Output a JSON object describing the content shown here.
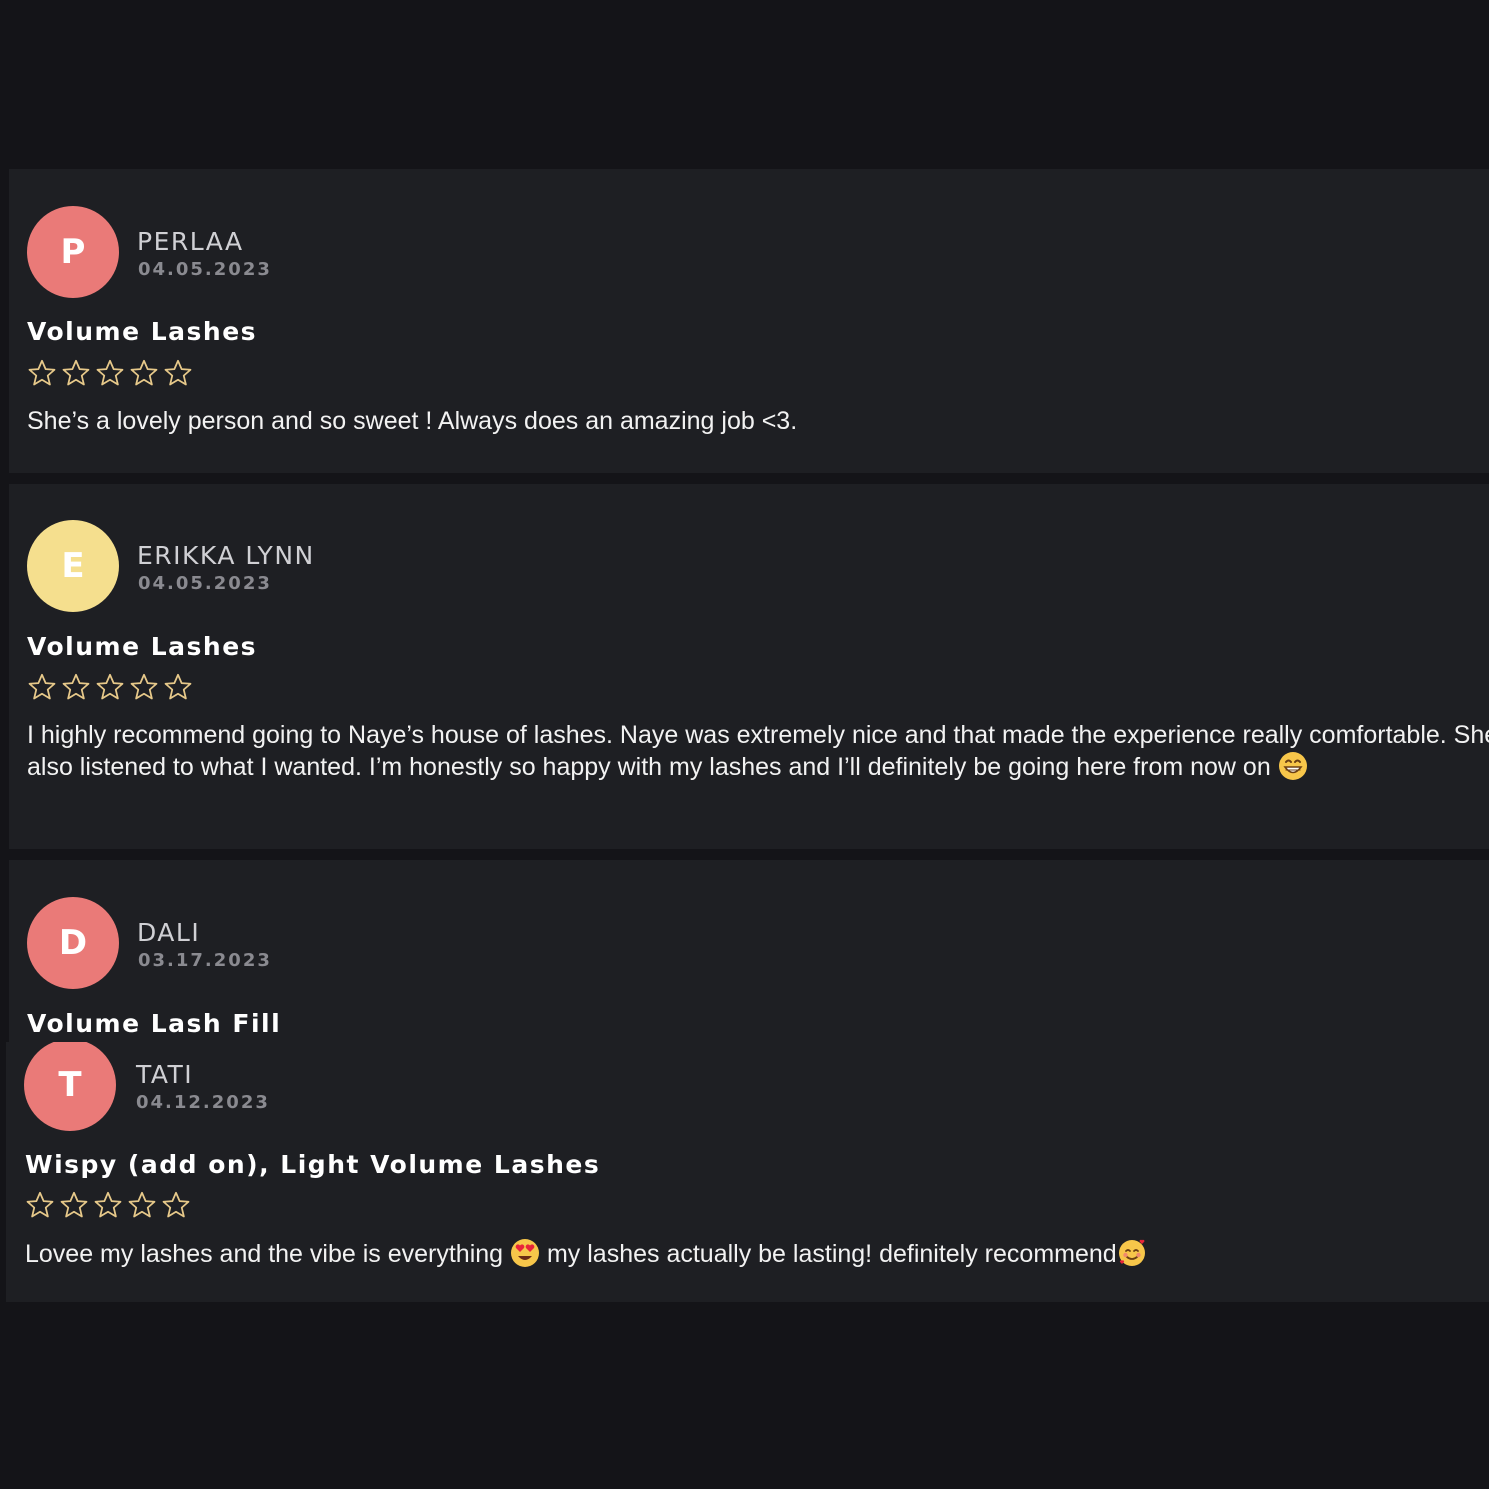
{
  "colors": {
    "background": "#141418",
    "card": "#1e1f23",
    "avatar_pink": "#ea7a78",
    "avatar_yellow": "#f5df8e",
    "star_outline": "#e7c98a"
  },
  "reviews": [
    {
      "initial": "P",
      "name": "PERLAA",
      "date": "04.05.2023",
      "service": "Volume Lashes",
      "rating": 5,
      "text": "She’s a lovely person and so sweet ! Always does an amazing job <3."
    },
    {
      "initial": "E",
      "name": "ERIKKA LYNN",
      "date": "04.05.2023",
      "service": "Volume Lashes",
      "rating": 5,
      "text": "I highly recommend going to Naye’s house of lashes. Naye was extremely nice and that made the experience really comfortable. She also listened to  what I wanted. I’m honestly so happy with my lashes and I’ll definitely be going here from now on",
      "emoji": "grinning-face-emoji"
    },
    {
      "initial": "D",
      "name": "DALI",
      "date": "03.17.2023",
      "service": "Volume Lash Fill"
    },
    {
      "initial": "T",
      "name": "TATI",
      "date": "04.12.2023",
      "service": "Wispy (add on), Light Volume Lashes",
      "rating": 5,
      "text_part1": "Lovee my lashes and the vibe is everything",
      "emoji1": "heart-eyes-emoji",
      "text_part2": " my lashes actually be lasting! definitely recommend",
      "emoji2": "smiling-hearts-emoji"
    }
  ]
}
